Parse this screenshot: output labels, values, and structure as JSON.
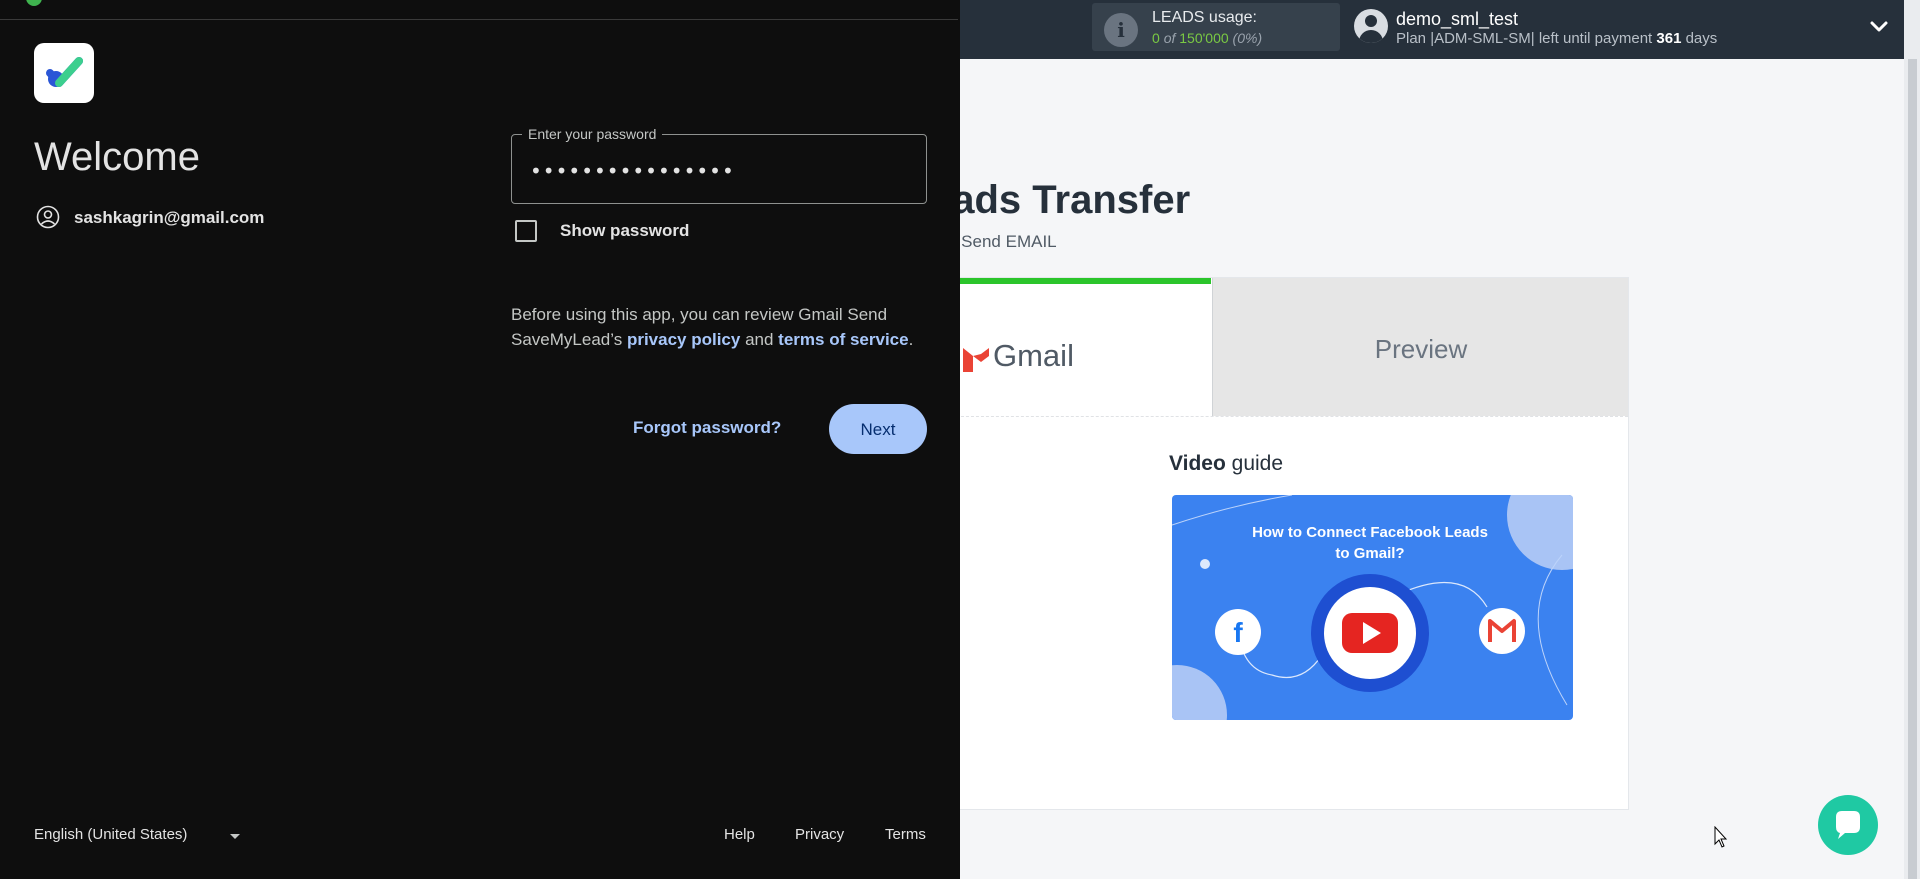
{
  "topbar": {
    "leads_usage_title": "LEADS usage:",
    "leads_used": "0",
    "leads_of": "of",
    "leads_total": "150'000",
    "leads_pct": "(0%)",
    "username": "demo_sml_test",
    "plan_prefix": "Plan |ADM-SML-SM| left until payment",
    "days_left": "361",
    "days_suffix": "days"
  },
  "main": {
    "page_title": "eads Transfer",
    "breadcrumb": "ail / Send EMAIL",
    "tabs": [
      {
        "label": "Gmail",
        "active": true
      },
      {
        "label": "Preview",
        "active": false
      }
    ],
    "video_heading_bold": "Video",
    "video_heading_rest": "guide",
    "video_title_line1": "How to Connect Facebook Leads",
    "video_title_line2": "to Gmail?"
  },
  "signin": {
    "welcome": "Welcome",
    "email": "sashkagrin@gmail.com",
    "password_label": "Enter your password",
    "password_value": "••••••••••••••••",
    "show_password_label": "Show password",
    "show_password_checked": false,
    "disclaimer_prefix": "Before using this app, you can review Gmail Send SaveMyLead’s",
    "privacy_link": "privacy policy",
    "disclaimer_and": "and",
    "terms_link": "terms of service",
    "disclaimer_suffix": ".",
    "forgot_password": "Forgot password?",
    "next_button": "Next",
    "language": "English (United States)",
    "footer": {
      "help": "Help",
      "privacy": "Privacy",
      "terms": "Terms"
    }
  },
  "colors": {
    "topbar_bg": "#26303b",
    "leads_green": "#7ac943",
    "active_tab_indicator": "#2bc52b",
    "signin_bg": "#0e0e0e",
    "signin_link": "#a8c7fa",
    "chat_button": "#1fc9a3"
  },
  "icons": [
    "info-icon",
    "user-avatar-icon",
    "chevron-down-icon",
    "gmail-icon",
    "play-icon",
    "facebook-icon",
    "chat-icon",
    "account-circle-icon",
    "app-checkmark-icon",
    "dropdown-caret-icon",
    "mouse-cursor-icon"
  ]
}
